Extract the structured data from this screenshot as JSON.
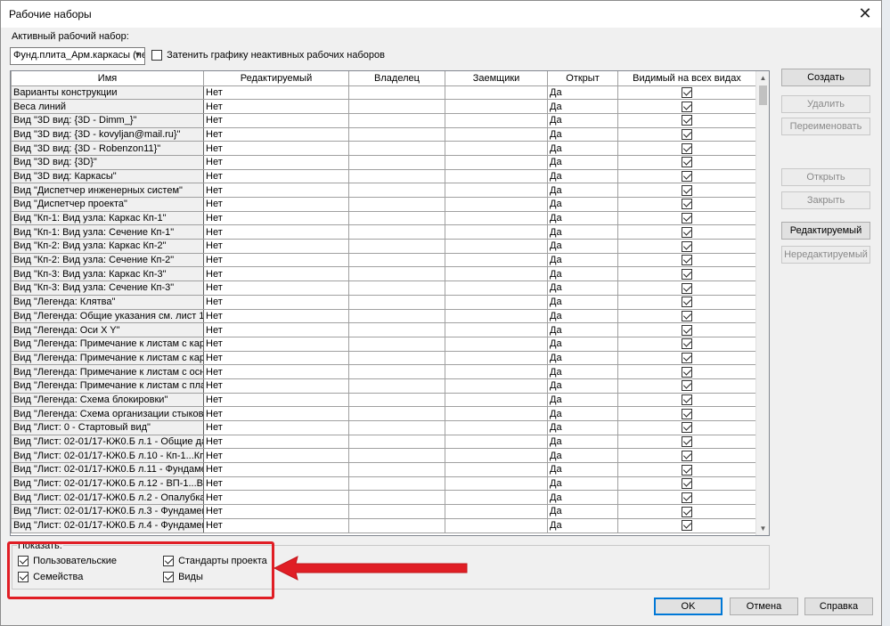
{
  "window": {
    "title": "Рабочие наборы",
    "close_glyph": "✕"
  },
  "active": {
    "label": "Активный рабочий набор:",
    "value": "Фунд.плита_Арм.каркасы (не",
    "dim_label": "Затенить графику неактивных рабочих наборов",
    "dim_checked": false
  },
  "columns": [
    "Имя",
    "Редактируемый",
    "Владелец",
    "Заемщики",
    "Открыт",
    "Видимый на всех видах"
  ],
  "rows": [
    {
      "name": "Варианты конструкции",
      "editable": "Нет",
      "owner": "",
      "borrowers": "",
      "open": "Да",
      "visible": true
    },
    {
      "name": "Веса линий",
      "editable": "Нет",
      "owner": "",
      "borrowers": "",
      "open": "Да",
      "visible": true
    },
    {
      "name": "Вид \"3D вид: {3D - Dimm_}\"",
      "editable": "Нет",
      "owner": "",
      "borrowers": "",
      "open": "Да",
      "visible": true
    },
    {
      "name": "Вид \"3D вид: {3D - kovyljan@mail.ru}\"",
      "editable": "Нет",
      "owner": "",
      "borrowers": "",
      "open": "Да",
      "visible": true
    },
    {
      "name": "Вид \"3D вид: {3D - Robenzon11}\"",
      "editable": "Нет",
      "owner": "",
      "borrowers": "",
      "open": "Да",
      "visible": true
    },
    {
      "name": "Вид \"3D вид: {3D}\"",
      "editable": "Нет",
      "owner": "",
      "borrowers": "",
      "open": "Да",
      "visible": true
    },
    {
      "name": "Вид \"3D вид: Каркасы\"",
      "editable": "Нет",
      "owner": "",
      "borrowers": "",
      "open": "Да",
      "visible": true
    },
    {
      "name": "Вид \"Диспетчер инженерных систем\"",
      "editable": "Нет",
      "owner": "",
      "borrowers": "",
      "open": "Да",
      "visible": true
    },
    {
      "name": "Вид \"Диспетчер проекта\"",
      "editable": "Нет",
      "owner": "",
      "borrowers": "",
      "open": "Да",
      "visible": true
    },
    {
      "name": "Вид \"Кп-1: Вид узла: Каркас Кп-1\"",
      "editable": "Нет",
      "owner": "",
      "borrowers": "",
      "open": "Да",
      "visible": true
    },
    {
      "name": "Вид \"Кп-1: Вид узла: Сечение Кп-1\"",
      "editable": "Нет",
      "owner": "",
      "borrowers": "",
      "open": "Да",
      "visible": true
    },
    {
      "name": "Вид \"Кп-2: Вид узла: Каркас Кп-2\"",
      "editable": "Нет",
      "owner": "",
      "borrowers": "",
      "open": "Да",
      "visible": true
    },
    {
      "name": "Вид \"Кп-2: Вид узла: Сечение Кп-2\"",
      "editable": "Нет",
      "owner": "",
      "borrowers": "",
      "open": "Да",
      "visible": true
    },
    {
      "name": "Вид \"Кп-3: Вид узла: Каркас Кп-3\"",
      "editable": "Нет",
      "owner": "",
      "borrowers": "",
      "open": "Да",
      "visible": true
    },
    {
      "name": "Вид \"Кп-3: Вид узла: Сечение Кп-3\"",
      "editable": "Нет",
      "owner": "",
      "borrowers": "",
      "open": "Да",
      "visible": true
    },
    {
      "name": "Вид \"Легенда: Клятва\"",
      "editable": "Нет",
      "owner": "",
      "borrowers": "",
      "open": "Да",
      "visible": true
    },
    {
      "name": "Вид \"Легенда: Общие указания см. лист 1\"",
      "editable": "Нет",
      "owner": "",
      "borrowers": "",
      "open": "Да",
      "visible": true
    },
    {
      "name": "Вид \"Легенда: Оси X Y\"",
      "editable": "Нет",
      "owner": "",
      "borrowers": "",
      "open": "Да",
      "visible": true
    },
    {
      "name": "Вид \"Легенда: Примечание к листам с карк",
      "editable": "Нет",
      "owner": "",
      "borrowers": "",
      "open": "Да",
      "visible": true
    },
    {
      "name": "Вид \"Легенда: Примечание к листам с карк",
      "editable": "Нет",
      "owner": "",
      "borrowers": "",
      "open": "Да",
      "visible": true
    },
    {
      "name": "Вид \"Легенда: Примечание к листам с осно",
      "editable": "Нет",
      "owner": "",
      "borrowers": "",
      "open": "Да",
      "visible": true
    },
    {
      "name": "Вид \"Легенда: Примечание к листам с план",
      "editable": "Нет",
      "owner": "",
      "borrowers": "",
      "open": "Да",
      "visible": true
    },
    {
      "name": "Вид \"Легенда: Схема блокировки\"",
      "editable": "Нет",
      "owner": "",
      "borrowers": "",
      "open": "Да",
      "visible": true
    },
    {
      "name": "Вид \"Легенда: Схема организации стыков о",
      "editable": "Нет",
      "owner": "",
      "borrowers": "",
      "open": "Да",
      "visible": true
    },
    {
      "name": "Вид \"Лист: 0 - Стартовый вид\"",
      "editable": "Нет",
      "owner": "",
      "borrowers": "",
      "open": "Да",
      "visible": true
    },
    {
      "name": "Вид \"Лист: 02-01/17-КЖ0.Б л.1 - Общие дан",
      "editable": "Нет",
      "owner": "",
      "borrowers": "",
      "open": "Да",
      "visible": true
    },
    {
      "name": "Вид \"Лист: 02-01/17-КЖ0.Б л.10 - Кп-1...Кп-3",
      "editable": "Нет",
      "owner": "",
      "borrowers": "",
      "open": "Да",
      "visible": true
    },
    {
      "name": "Вид \"Лист: 02-01/17-КЖ0.Б л.11 - Фундамент",
      "editable": "Нет",
      "owner": "",
      "borrowers": "",
      "open": "Да",
      "visible": true
    },
    {
      "name": "Вид \"Лист: 02-01/17-КЖ0.Б л.12 - ВП-1...ВП-",
      "editable": "Нет",
      "owner": "",
      "borrowers": "",
      "open": "Да",
      "visible": true
    },
    {
      "name": "Вид \"Лист: 02-01/17-КЖ0.Б л.2 - Опалубка ф",
      "editable": "Нет",
      "owner": "",
      "borrowers": "",
      "open": "Да",
      "visible": true
    },
    {
      "name": "Вид \"Лист: 02-01/17-КЖ0.Б л.3 - Фундаментн",
      "editable": "Нет",
      "owner": "",
      "borrowers": "",
      "open": "Да",
      "visible": true
    },
    {
      "name": "Вид \"Лист: 02-01/17-КЖ0.Б л.4 - Фундаментн",
      "editable": "Нет",
      "owner": "",
      "borrowers": "",
      "open": "Да",
      "visible": true
    }
  ],
  "scrollbar": {
    "up_glyph": "▲",
    "down_glyph": "▼"
  },
  "side_buttons": [
    {
      "label": "Создать",
      "enabled": true
    },
    {
      "label": "Удалить",
      "enabled": false
    },
    {
      "label": "Переименовать",
      "enabled": false
    },
    {
      "label": "Открыть",
      "enabled": false
    },
    {
      "label": "Закрыть",
      "enabled": false
    },
    {
      "label": "Редактируемый",
      "enabled": true
    },
    {
      "label": "Нередактируемый",
      "enabled": false
    }
  ],
  "show": {
    "label": "Показать:",
    "options": [
      {
        "label": "Пользовательские",
        "checked": true
      },
      {
        "label": "Стандарты проекта",
        "checked": true
      },
      {
        "label": "Семейства",
        "checked": true
      },
      {
        "label": "Виды",
        "checked": true
      }
    ]
  },
  "annotation": {
    "highlight_color": "#e01e25"
  },
  "footer": {
    "ok": "OK",
    "cancel": "Отмена",
    "help": "Справка"
  }
}
